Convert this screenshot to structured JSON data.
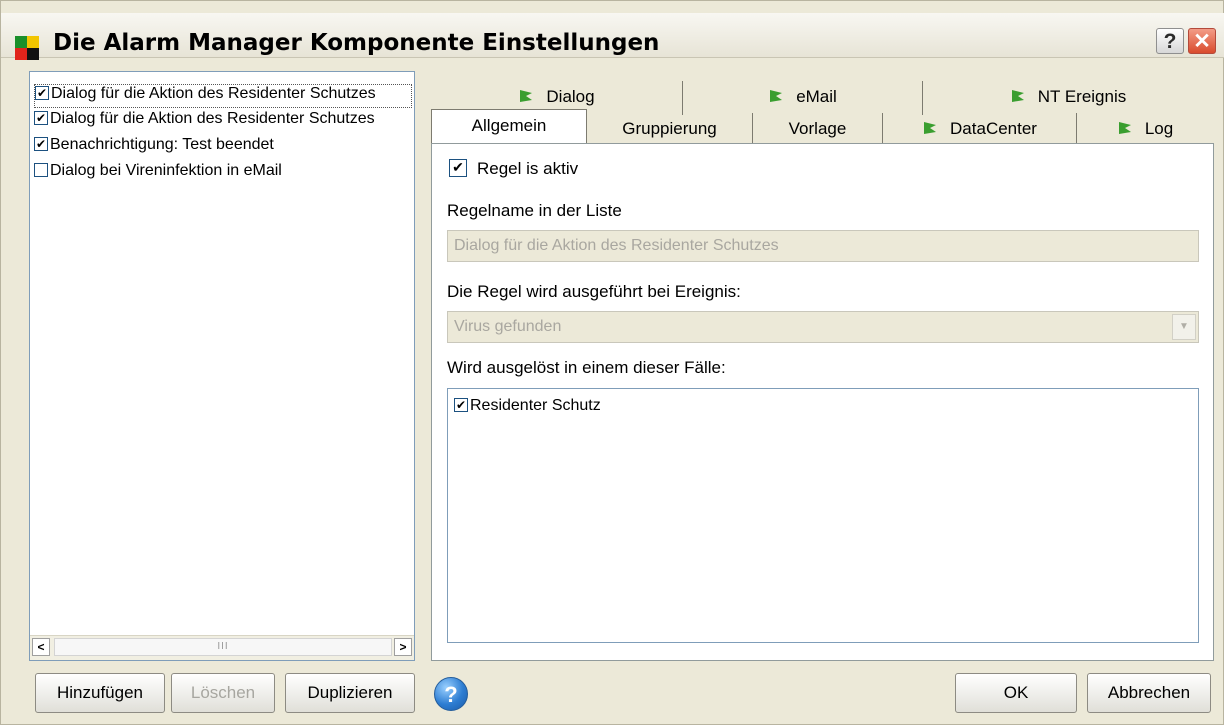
{
  "window": {
    "title": "Die Alarm Manager Komponente Einstellungen",
    "help_glyph": "?",
    "close_glyph": "✕"
  },
  "rules": [
    {
      "label": "Dialog für die Aktion des Residenter Schutzes",
      "checked": true,
      "selected": true
    },
    {
      "label": "Dialog für die Aktion des Residenter Schutzes",
      "checked": true,
      "selected": false
    },
    {
      "label": "Benachrichtigung: Test beendet",
      "checked": true,
      "selected": false
    },
    {
      "label": "Dialog bei Vireninfektion in eMail",
      "checked": false,
      "selected": false
    }
  ],
  "scrollbar": {
    "left_arrow": "<",
    "right_arrow": ">",
    "thumb_grip": "III"
  },
  "tabs": {
    "top_row": [
      "Dialog",
      "eMail",
      "NT Ereignis"
    ],
    "bottom_row": [
      "Allgemein",
      "Gruppierung",
      "Vorlage",
      "DataCenter",
      "Log"
    ],
    "active": "Allgemein"
  },
  "general": {
    "rule_active_label": "Regel is aktiv",
    "rule_active_checked": true,
    "name_label": "Regelname in der Liste",
    "name_value": "Dialog für die Aktion des Residenter Schutzes",
    "event_label": "Die Regel wird ausgeführt bei Ereignis:",
    "event_value": "Virus gefunden",
    "cases_label": "Wird ausgelöst in einem dieser Fälle:",
    "cases": [
      {
        "label": "Residenter Schutz",
        "checked": true
      }
    ]
  },
  "buttons": {
    "add": "Hinzufügen",
    "delete": "Löschen",
    "duplicate": "Duplizieren",
    "help": "?",
    "ok": "OK",
    "cancel": "Abbrechen"
  },
  "colors": {
    "flag_green": "#3a9e2f",
    "selection_border": "#555555"
  }
}
